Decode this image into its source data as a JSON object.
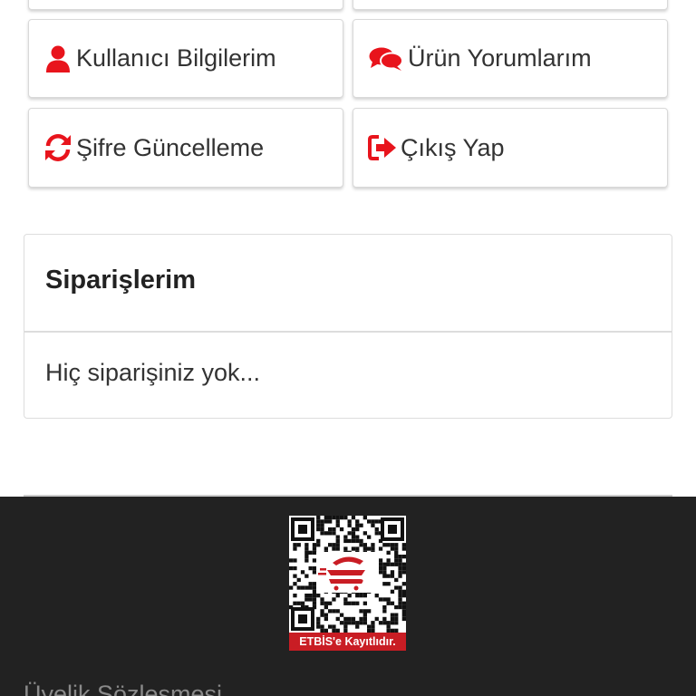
{
  "account_menu": {
    "items": [
      {
        "label": "",
        "icon": "blank"
      },
      {
        "label": "",
        "icon": "blank"
      },
      {
        "label": "Kullanıcı Bilgilerim",
        "icon": "user-icon"
      },
      {
        "label": "Ürün Yorumlarım",
        "icon": "comments-icon"
      },
      {
        "label": "Şifre Güncelleme",
        "icon": "refresh-icon"
      },
      {
        "label": "Çıkış Yap",
        "icon": "sign-out-icon"
      }
    ],
    "icon_color": "#e8141c"
  },
  "orders": {
    "title": "Siparişlerim",
    "empty_message": "Hiç siparişiniz yok..."
  },
  "footer": {
    "background": "#222222",
    "etbis_caption": "ETBİS'e Kayıtlıdır.",
    "etbis_color": "#c91d24",
    "link_membership": "Üyelik Sözleşmesi"
  }
}
